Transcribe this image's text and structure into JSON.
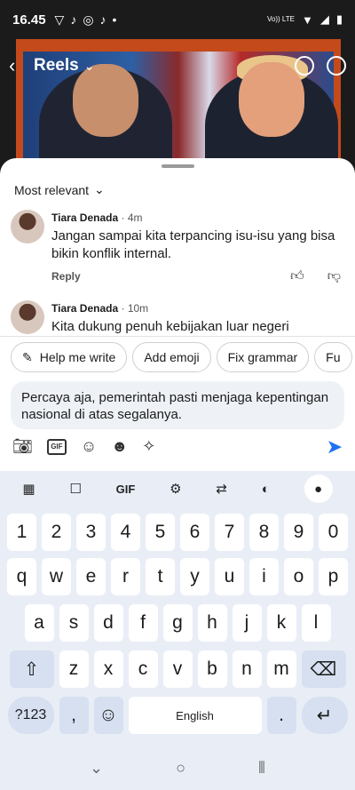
{
  "status_bar": {
    "time": "16.45",
    "network": "Vo)) LTE"
  },
  "reels_header": {
    "title": "Reels"
  },
  "comments": {
    "sort_label": "Most relevant",
    "items": [
      {
        "author": "Tiara Denada",
        "time_ago": "· 4m",
        "text": "Jangan sampai kita terpancing isu-isu yang bisa bikin konflik internal.",
        "reply_label": "Reply"
      },
      {
        "author": "Tiara Denada",
        "time_ago": "· 10m",
        "text": "Kita dukung penuh kebijakan luar negeri"
      }
    ]
  },
  "suggestions": [
    "Help me write",
    "Add emoji",
    "Fix grammar",
    "Fu"
  ],
  "composer": {
    "text": "Percaya aja, pemerintah pasti menjaga kepentingan nasional di atas segalanya.",
    "gif_label": "GIF"
  },
  "keyboard": {
    "toolbar_gif": "GIF",
    "row_numbers": [
      "1",
      "2",
      "3",
      "4",
      "5",
      "6",
      "7",
      "8",
      "9",
      "0"
    ],
    "row_1": [
      "q",
      "w",
      "e",
      "r",
      "t",
      "y",
      "u",
      "i",
      "o",
      "p"
    ],
    "row_2": [
      "a",
      "s",
      "d",
      "f",
      "g",
      "h",
      "j",
      "k",
      "l"
    ],
    "row_3": [
      "z",
      "x",
      "c",
      "v",
      "b",
      "n",
      "m"
    ],
    "symbols_label": "?123",
    "comma": ",",
    "space_label": "English",
    "period": "."
  },
  "colors": {
    "accent": "#1d72f2",
    "key_special": "#d6e0f0",
    "keyboard_bg": "#e9eef6"
  }
}
